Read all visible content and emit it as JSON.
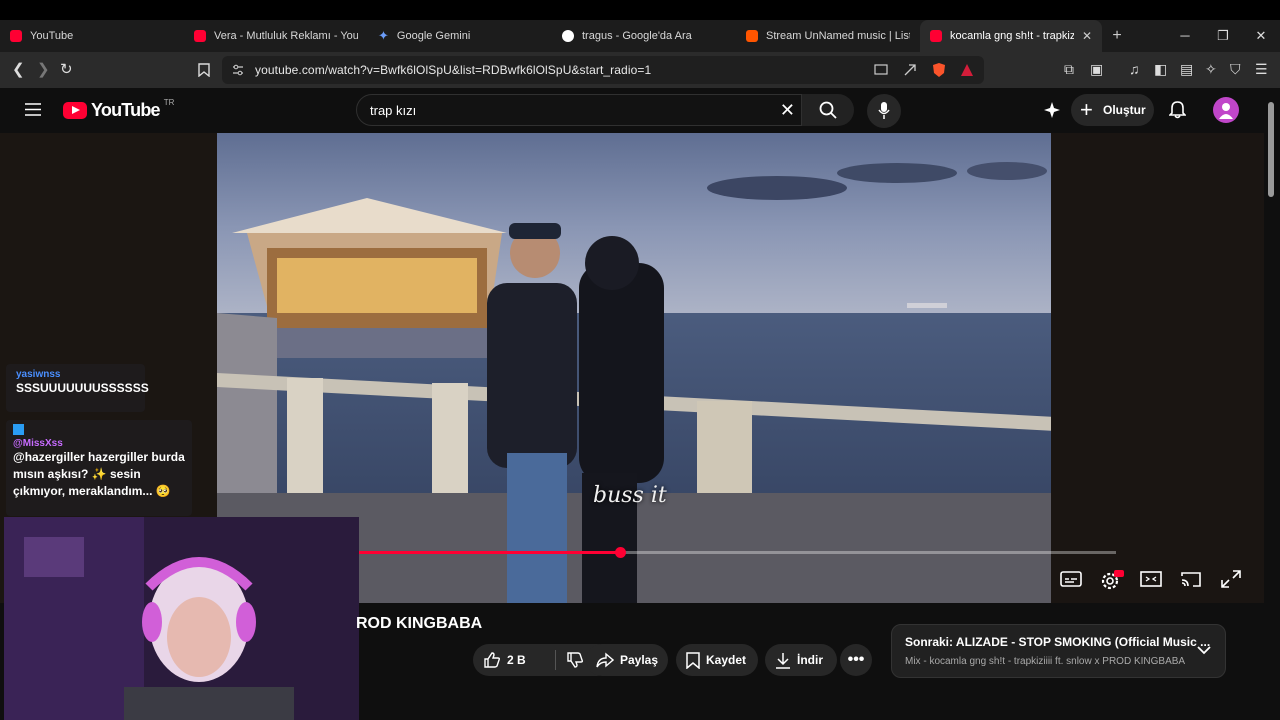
{
  "browser": {
    "tabs": [
      {
        "title": "YouTube",
        "favicon_color": "#ff0033"
      },
      {
        "title": "Vera - Mutluluk Reklamı - YouTu",
        "favicon_color": "#ff0033"
      },
      {
        "title": "Google Gemini",
        "favicon_color": "#4b8df8"
      },
      {
        "title": "tragus - Google'da Ara",
        "favicon_color": "#ffffff"
      },
      {
        "title": "Stream UnNamed music | Listen",
        "favicon_color": "#ff5500"
      },
      {
        "title": "kocamla gng sh!t - trapkiziii",
        "favicon_color": "#ff0033",
        "active": true
      }
    ],
    "new_tab": "+",
    "url": "youtube.com/watch?v=Bwfk6lOlSpU&list=RDBwfk6lOlSpU&start_radio=1",
    "window_controls": {
      "minimize": "─",
      "restore": "❐",
      "close": "✕"
    }
  },
  "youtube": {
    "logo_text": "YouTube",
    "country_code": "TR",
    "search_query": "trap kızı",
    "create_label": "Oluştur",
    "accent": "#ff0033"
  },
  "player": {
    "caption": "buss it",
    "progress": 0.345
  },
  "chat": [
    {
      "user": "yasiwnss",
      "message": "SSSUUUUUUUSSSSSS"
    },
    {
      "user": "@MissXss",
      "message": "@hazergiller hazergiller burda mısın aşkısı? ✨ sesin çıkmıyor, meraklandım... 🥺"
    }
  ],
  "video": {
    "title_visible": "ROD KINGBABA",
    "like_count": "2 B",
    "share_label": "Paylaş",
    "save_label": "Kaydet",
    "download_label": "İndir"
  },
  "up_next": {
    "line1": "Sonraki: ALIZADE - STOP SMOKING (Official Music ...",
    "line2": "Mix - kocamla gng sh!t - trapkiziiii ft. snlow x PROD KINGBABA"
  }
}
